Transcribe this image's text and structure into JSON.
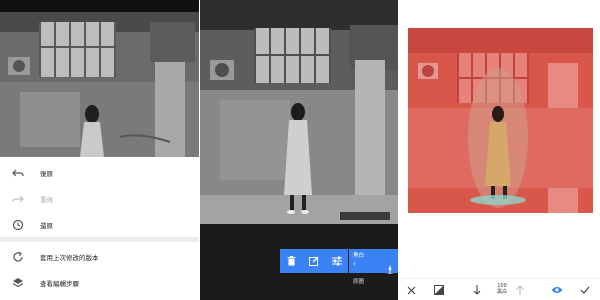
{
  "history_menu": {
    "items": [
      {
        "label": "復原",
        "enabled": true
      },
      {
        "label": "重做",
        "enabled": false
      },
      {
        "label": "還原",
        "enabled": true
      },
      {
        "label": "套用上次修改的版本",
        "enabled": true
      },
      {
        "label": "查看編輯步驟",
        "enabled": true
      }
    ]
  },
  "stack_popup": {
    "filter_label": "黑白",
    "back_label": "‹",
    "original_label": "原圖"
  },
  "brush_bar": {
    "value": "100",
    "filter_label": "黑白"
  },
  "colors": {
    "accent": "#3b82f4",
    "mask": "#e34a40",
    "dark": "#1b1b1b"
  }
}
